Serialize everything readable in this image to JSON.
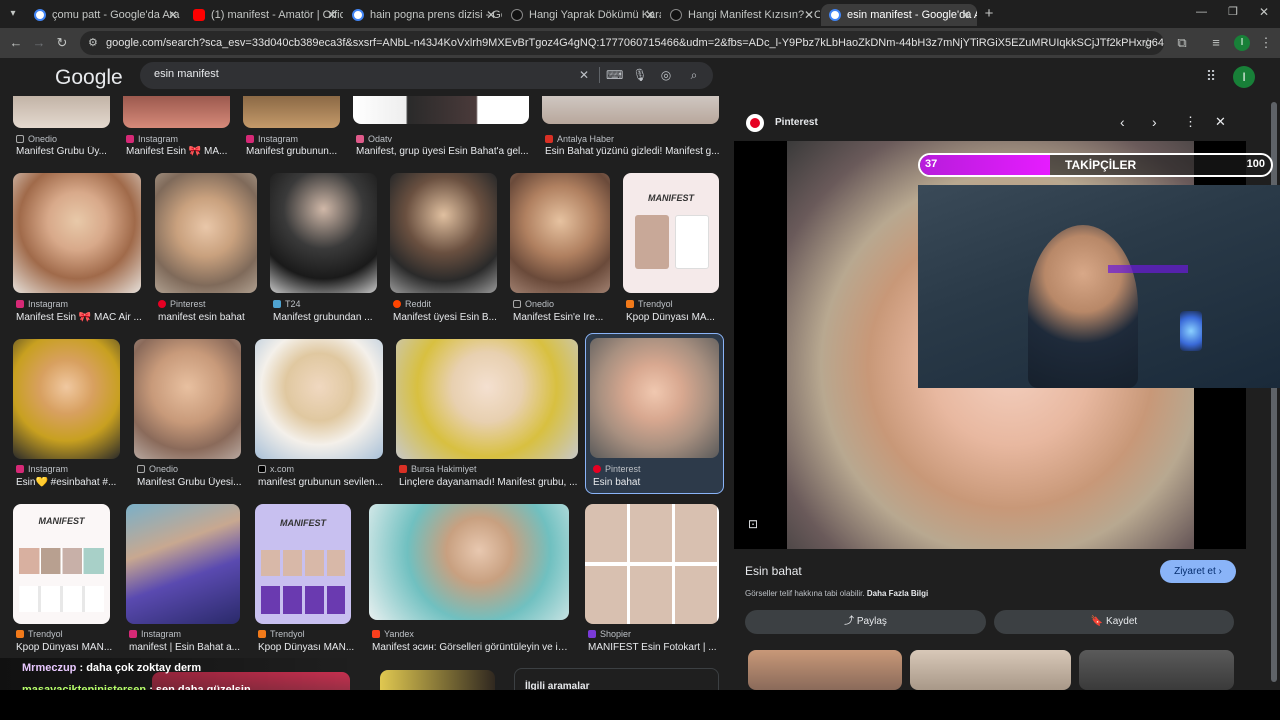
{
  "tabs": [
    {
      "label": "çomu patt - Google'da Ara",
      "favicon": "google-icon",
      "active": false
    },
    {
      "label": "(1) manifest - Amatör | Offic",
      "favicon": "youtube-icon",
      "active": false
    },
    {
      "label": "hain pogna prens dizisi - Goog",
      "favicon": "google-icon",
      "active": false
    },
    {
      "label": "Hangi Yaprak Dökümü Karakter",
      "favicon": "onedio-icon",
      "active": false
    },
    {
      "label": "Hangi Manifest Kızısın? - Oned",
      "favicon": "onedio-icon",
      "active": false
    },
    {
      "label": "esin manifest - Google'da Ara",
      "favicon": "google-icon",
      "active": true
    }
  ],
  "address_bar": {
    "url": "google.com/search?sca_esv=33d040cb389eca3f&sxsrf=ANbL-n43J4KoVxlrh9MXEvBrTgoz4G4gNQ:1777060715466&udm=2&fbs=ADc_l-Y9Pbz7kLbHaoZkDNm-44bH3z7mNjYTiRGiX5EZuMRUIqkkSCjJTf2kPHxrg64IlbmdyZIDWCg6rbvB1MgosL8wNMb..."
  },
  "google": {
    "logo": "Google",
    "search_value": "esin manifest",
    "avatar_letter": "I"
  },
  "results_row1": [
    {
      "source": "Onedio",
      "title": "Manifest Grubu Üy..."
    },
    {
      "source": "Instagram",
      "title": "Manifest Esin 🎀 MA..."
    },
    {
      "source": "Instagram",
      "title": "Manifest grubunun..."
    },
    {
      "source": "Odatv",
      "title": "Manifest, grup üyesi Esin Bahat'a gel..."
    },
    {
      "source": "Antalya Haber",
      "title": "Esin Bahat yüzünü gizledi! Manifest g..."
    }
  ],
  "results_row2": [
    {
      "source": "Instagram",
      "title": "Manifest Esin 🎀 MAC Air ..."
    },
    {
      "source": "Pinterest",
      "title": "manifest esin bahat"
    },
    {
      "source": "T24",
      "title": "Manifest grubundan ..."
    },
    {
      "source": "Reddit",
      "title": "Manifest üyesi Esin B..."
    },
    {
      "source": "Onedio",
      "title": "Manifest Esin'e İre..."
    },
    {
      "source": "Trendyol",
      "title": "Kpop Dünyası MA..."
    }
  ],
  "results_row3": [
    {
      "source": "Instagram",
      "title": "Esin💛 #esinbahat #..."
    },
    {
      "source": "Onedio",
      "title": "Manifest Grubu Üyesi..."
    },
    {
      "source": "x.com",
      "title": "manifest grubunun sevilen..."
    },
    {
      "source": "Bursa Hakimiyet",
      "title": "Linçlere dayanamadı! Manifest grubu, ..."
    },
    {
      "source": "Pinterest",
      "title": "Esin bahat"
    }
  ],
  "results_row4": [
    {
      "source": "Trendyol",
      "title": "Kpop Dünyası MAN..."
    },
    {
      "source": "Instagram",
      "title": "manifest | Esin Bahat a..."
    },
    {
      "source": "Trendyol",
      "title": "Kpop Dünyası MAN..."
    },
    {
      "source": "Yandex",
      "title": "Manifest эсин: Görselleri görüntüleyin ve ind..."
    },
    {
      "source": "Shopier",
      "title": "MANIFEST Esin Fotokart | ..."
    }
  ],
  "thumb_text": {
    "manifest_card": "MANIFEST"
  },
  "related_label": "İlgili aramalar",
  "preview": {
    "source": "Pinterest",
    "title": "Esin bahat",
    "visit_label": "Ziyaret et",
    "copyright_note": "Görseller telif hakkına tabi olabilir.",
    "more_info": "Daha Fazla Bilgi",
    "share_label": "Paylaş",
    "save_label": "Kaydet"
  },
  "stream_overlay": {
    "followers_current": "37",
    "followers_label": "TAKİPÇİLER",
    "followers_goal": "100",
    "progress_fraction": 0.37
  },
  "chat": [
    {
      "user": "Mrmeczup",
      "message": ": daha çok zoktay derm",
      "color": "#e8c8ff"
    },
    {
      "user": "masayaciktepinistersen",
      "message": ": sen daha güzelsin",
      "color": "#b7ff6b"
    }
  ],
  "colors": {
    "bg": "#1f1f1f",
    "accent_blue": "#8ab4f8",
    "follow_fill": "#e61cff"
  }
}
